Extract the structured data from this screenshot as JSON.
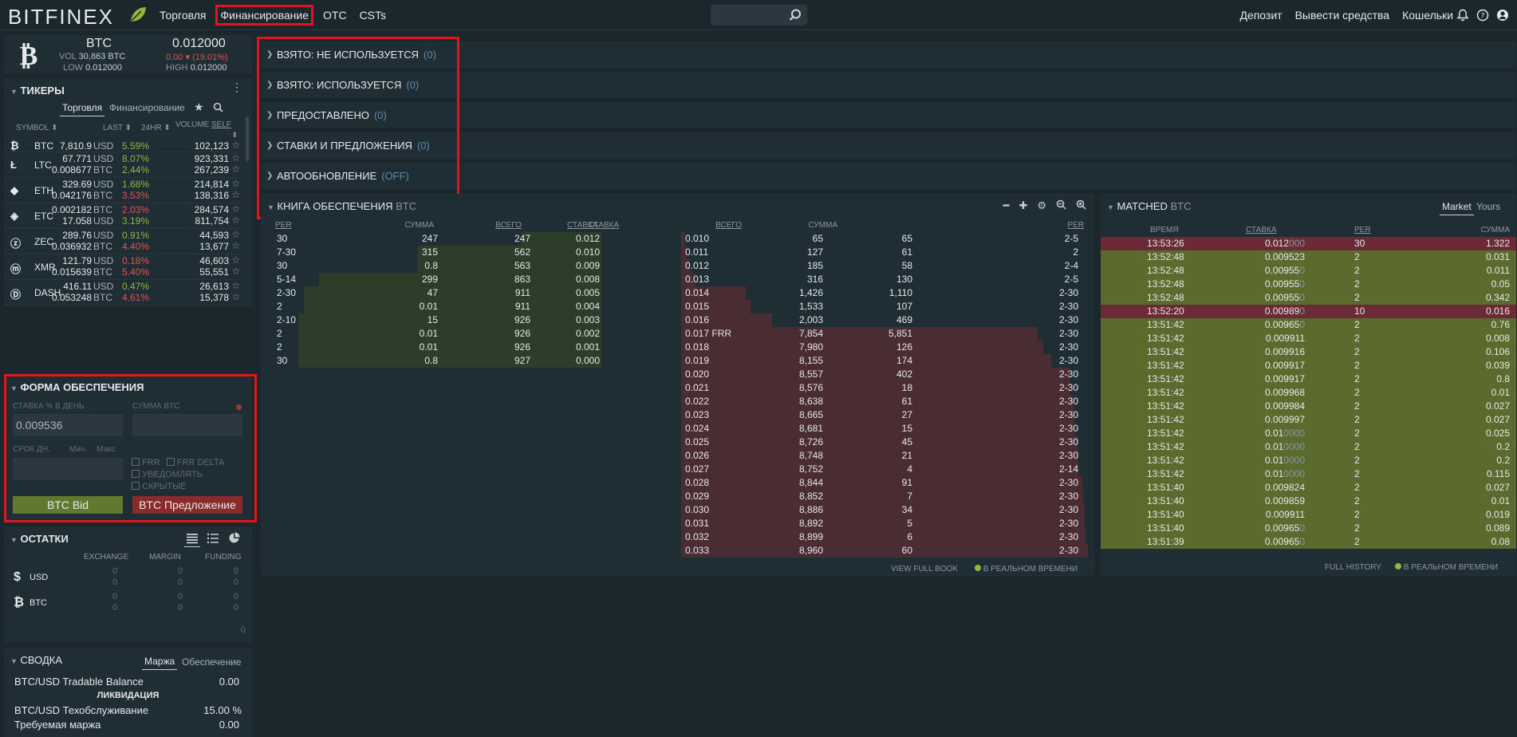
{
  "header": {
    "logo": "BITFINEX",
    "nav": [
      "Торговля",
      "Финансирование",
      "OTC",
      "CSTs"
    ],
    "right": [
      "Депозит",
      "Вывести средства",
      "Кошельки"
    ],
    "search_placeholder": ""
  },
  "summary": {
    "symbol": "BTC",
    "price": "0.012000",
    "vol_label": "VOL",
    "vol": "30,863 BTC",
    "change": "0.00",
    "change_pct": "(19.01%)",
    "low_label": "LOW",
    "low": "0.012000",
    "high_label": "HIGH",
    "high": "0.012000"
  },
  "tickers": {
    "title": "ТИКЕРЫ",
    "tabs": [
      "Торговля",
      "Финансирование"
    ],
    "cols": [
      "SYMBOL",
      "LAST",
      "24HR",
      "VOLUME",
      "SELF"
    ],
    "rows": [
      {
        "sym": "BTC",
        "lines": [
          {
            "last": "7,810.9",
            "cur": "USD",
            "chg": "5.59%",
            "up": true,
            "vol": "102,123"
          }
        ]
      },
      {
        "sym": "LTC",
        "lines": [
          {
            "last": "67.771",
            "cur": "USD",
            "chg": "8.07%",
            "up": true,
            "vol": "923,331"
          },
          {
            "last": "0.008677",
            "cur": "BTC",
            "chg": "2.44%",
            "up": true,
            "vol": "267,239"
          }
        ]
      },
      {
        "sym": "ETH",
        "lines": [
          {
            "last": "329.69",
            "cur": "USD",
            "chg": "1.68%",
            "up": true,
            "vol": "214,814"
          },
          {
            "last": "0.042176",
            "cur": "BTC",
            "chg": "3.53%",
            "up": false,
            "vol": "138,316"
          }
        ]
      },
      {
        "sym": "ETC",
        "lines": [
          {
            "last": "0.002182",
            "cur": "BTC",
            "chg": "2.03%",
            "up": false,
            "vol": "284,574"
          },
          {
            "last": "17.058",
            "cur": "USD",
            "chg": "3.19%",
            "up": true,
            "vol": "811,754"
          }
        ]
      },
      {
        "sym": "ZEC",
        "lines": [
          {
            "last": "289.76",
            "cur": "USD",
            "chg": "0.91%",
            "up": true,
            "vol": "44,593"
          },
          {
            "last": "0.036932",
            "cur": "BTC",
            "chg": "4.40%",
            "up": false,
            "vol": "13,677"
          }
        ]
      },
      {
        "sym": "XMR",
        "lines": [
          {
            "last": "121.79",
            "cur": "USD",
            "chg": "0.18%",
            "up": false,
            "vol": "46,603"
          },
          {
            "last": "0.015639",
            "cur": "BTC",
            "chg": "5.40%",
            "up": false,
            "vol": "55,551"
          }
        ]
      },
      {
        "sym": "DASH",
        "lines": [
          {
            "last": "416.11",
            "cur": "USD",
            "chg": "0.47%",
            "up": true,
            "vol": "26,613"
          },
          {
            "last": "0.053248",
            "cur": "BTC",
            "chg": "4.61%",
            "up": false,
            "vol": "15,378"
          }
        ]
      }
    ]
  },
  "form": {
    "title": "ФОРМА ОБЕСПЕЧЕНИЯ",
    "rate_label": "СТАВКА % В ДЕНЬ",
    "amount_label": "СУММА BTC",
    "rate_value": "0.009536",
    "days_label": "СРОК ДН.",
    "min": "Мин.",
    "max": "Макс.",
    "frr": "FRR",
    "frr_delta": "FRR DELTA",
    "notify": "УВЕДОМЛЯТЬ",
    "hidden": "СКРЫТЫЕ",
    "bid": "BTC Bid",
    "offer": "BTC Предложение"
  },
  "balances": {
    "title": "ОСТАТКИ",
    "cols": [
      "EXCHANGE",
      "MARGIN",
      "FUNDING"
    ],
    "rows": [
      {
        "cur": "USD",
        "v": [
          "0",
          "0",
          "0"
        ],
        "v2": [
          "0",
          "0",
          "0"
        ]
      },
      {
        "cur": "BTC",
        "v": [
          "0",
          "0",
          "0"
        ],
        "v2": [
          "0",
          "0",
          "0"
        ]
      }
    ],
    "total": "0"
  },
  "summary2": {
    "title": "СВОДКА",
    "tabs": [
      "Маржа",
      "Обеспечение"
    ],
    "l1": "BTC/USD Tradable Balance",
    "v1": "0.00",
    "liq": "ЛИКВИДАЦИЯ",
    "l2": "BTC/USD Техобслуживание",
    "v2": "15.00",
    "pct": "%",
    "l3": "Требуемая маржа",
    "v3": "0.00"
  },
  "sections": [
    {
      "t": "ВЗЯТО: НЕ ИСПОЛЬЗУЕТСЯ",
      "c": "(0)"
    },
    {
      "t": "ВЗЯТО: ИСПОЛЬЗУЕТСЯ",
      "c": "(0)"
    },
    {
      "t": "ПРЕДОСТАВЛЕНО",
      "c": "(0)"
    },
    {
      "t": "СТАВКИ И ПРЕДЛОЖЕНИЯ",
      "c": "(0)"
    },
    {
      "t": "АВТООБНОВЛЕНИЕ",
      "c": "(OFF)"
    }
  ],
  "book": {
    "title": "КНИГА ОБЕСПЕЧЕНИЯ",
    "cur": "BTC",
    "bid_cols": [
      "PER",
      "СУММА",
      "ВСЕГО",
      "СТАВКА"
    ],
    "ask_cols": [
      "СТАВКА",
      "ВСЕГО",
      "СУММА",
      "PER"
    ],
    "bids": [
      [
        "30",
        "247",
        "247",
        "0.012"
      ],
      [
        "7-30",
        "315",
        "562",
        "0.010"
      ],
      [
        "30",
        "0.8",
        "563",
        "0.009"
      ],
      [
        "5-14",
        "299",
        "863",
        "0.008"
      ],
      [
        "2-30",
        "47",
        "911",
        "0.005"
      ],
      [
        "2",
        "0.01",
        "911",
        "0.004"
      ],
      [
        "2-10",
        "15",
        "926",
        "0.003"
      ],
      [
        "2",
        "0.01",
        "926",
        "0.002"
      ],
      [
        "2",
        "0.01",
        "926",
        "0.001"
      ],
      [
        "30",
        "0.8",
        "927",
        "0.000"
      ]
    ],
    "asks": [
      [
        "0.010",
        "65",
        "65",
        "2-5"
      ],
      [
        "0.011",
        "127",
        "61",
        "2"
      ],
      [
        "0.012",
        "185",
        "58",
        "2-4"
      ],
      [
        "0.013",
        "316",
        "130",
        "2-5"
      ],
      [
        "0.014",
        "1,426",
        "1,110",
        "2-30"
      ],
      [
        "0.015",
        "1,533",
        "107",
        "2-30"
      ],
      [
        "0.016",
        "2,003",
        "469",
        "2-30"
      ],
      [
        "0.017 FRR",
        "7,854",
        "5,851",
        "2-30"
      ],
      [
        "0.018",
        "7,980",
        "126",
        "2-30"
      ],
      [
        "0.019",
        "8,155",
        "174",
        "2-30"
      ],
      [
        "0.020",
        "8,557",
        "402",
        "2-30"
      ],
      [
        "0.021",
        "8,576",
        "18",
        "2-30"
      ],
      [
        "0.022",
        "8,638",
        "61",
        "2-30"
      ],
      [
        "0.023",
        "8,665",
        "27",
        "2-30"
      ],
      [
        "0.024",
        "8,681",
        "15",
        "2-30"
      ],
      [
        "0.025",
        "8,726",
        "45",
        "2-30"
      ],
      [
        "0.026",
        "8,748",
        "21",
        "2-30"
      ],
      [
        "0.027",
        "8,752",
        "4",
        "2-14"
      ],
      [
        "0.028",
        "8,844",
        "91",
        "2-30"
      ],
      [
        "0.029",
        "8,852",
        "7",
        "2-30"
      ],
      [
        "0.030",
        "8,886",
        "34",
        "2-30"
      ],
      [
        "0.031",
        "8,892",
        "5",
        "2-30"
      ],
      [
        "0.032",
        "8,899",
        "6",
        "2-30"
      ],
      [
        "0.033",
        "8,960",
        "60",
        "2-30"
      ]
    ],
    "view_full": "VIEW FULL BOOK",
    "realtime": "В РЕАЛЬНОМ ВРЕМЕНИ"
  },
  "matched": {
    "title": "MATCHED",
    "cur": "BTC",
    "tabs": [
      "Market",
      "Yours"
    ],
    "cols": [
      "ВРЕМЯ",
      "СТАВКА",
      "PER",
      "СУММА"
    ],
    "rows": [
      [
        "13:53:26",
        "0.012",
        "000",
        "30",
        "1.322",
        false
      ],
      [
        "13:52:48",
        "0.009523",
        "",
        "2",
        "0.031",
        true
      ],
      [
        "13:52:48",
        "0.00955",
        "0",
        "2",
        "0.011",
        true
      ],
      [
        "13:52:48",
        "0.00955",
        "0",
        "2",
        "0.05",
        true
      ],
      [
        "13:52:48",
        "0.00955",
        "0",
        "2",
        "0.342",
        true
      ],
      [
        "13:52:20",
        "0.00989",
        "0",
        "10",
        "0.016",
        false
      ],
      [
        "13:51:42",
        "0.00965",
        "0",
        "2",
        "0.76",
        true
      ],
      [
        "13:51:42",
        "0.009911",
        "",
        "2",
        "0.008",
        true
      ],
      [
        "13:51:42",
        "0.009916",
        "",
        "2",
        "0.106",
        true
      ],
      [
        "13:51:42",
        "0.009917",
        "",
        "2",
        "0.039",
        true
      ],
      [
        "13:51:42",
        "0.009917",
        "",
        "2",
        "0.8",
        true
      ],
      [
        "13:51:42",
        "0.009968",
        "",
        "2",
        "0.01",
        true
      ],
      [
        "13:51:42",
        "0.009984",
        "",
        "2",
        "0.027",
        true
      ],
      [
        "13:51:42",
        "0.009997",
        "",
        "2",
        "0.027",
        true
      ],
      [
        "13:51:42",
        "0.01",
        "0000",
        "2",
        "0.025",
        true
      ],
      [
        "13:51:42",
        "0.01",
        "0000",
        "2",
        "0.2",
        true
      ],
      [
        "13:51:42",
        "0.01",
        "0000",
        "2",
        "0.2",
        true
      ],
      [
        "13:51:42",
        "0.01",
        "0000",
        "2",
        "0.115",
        true
      ],
      [
        "13:51:40",
        "0.009824",
        "",
        "2",
        "0.027",
        true
      ],
      [
        "13:51:40",
        "0.009859",
        "",
        "2",
        "0.01",
        true
      ],
      [
        "13:51:40",
        "0.009911",
        "",
        "2",
        "0.019",
        true
      ],
      [
        "13:51:40",
        "0.00965",
        "0",
        "2",
        "0.089",
        true
      ],
      [
        "13:51:39",
        "0.00965",
        "0",
        "2",
        "0.08",
        true
      ]
    ],
    "full_history": "FULL HISTORY",
    "realtime": "В РЕАЛЬНОМ ВРЕМЕНИ"
  }
}
